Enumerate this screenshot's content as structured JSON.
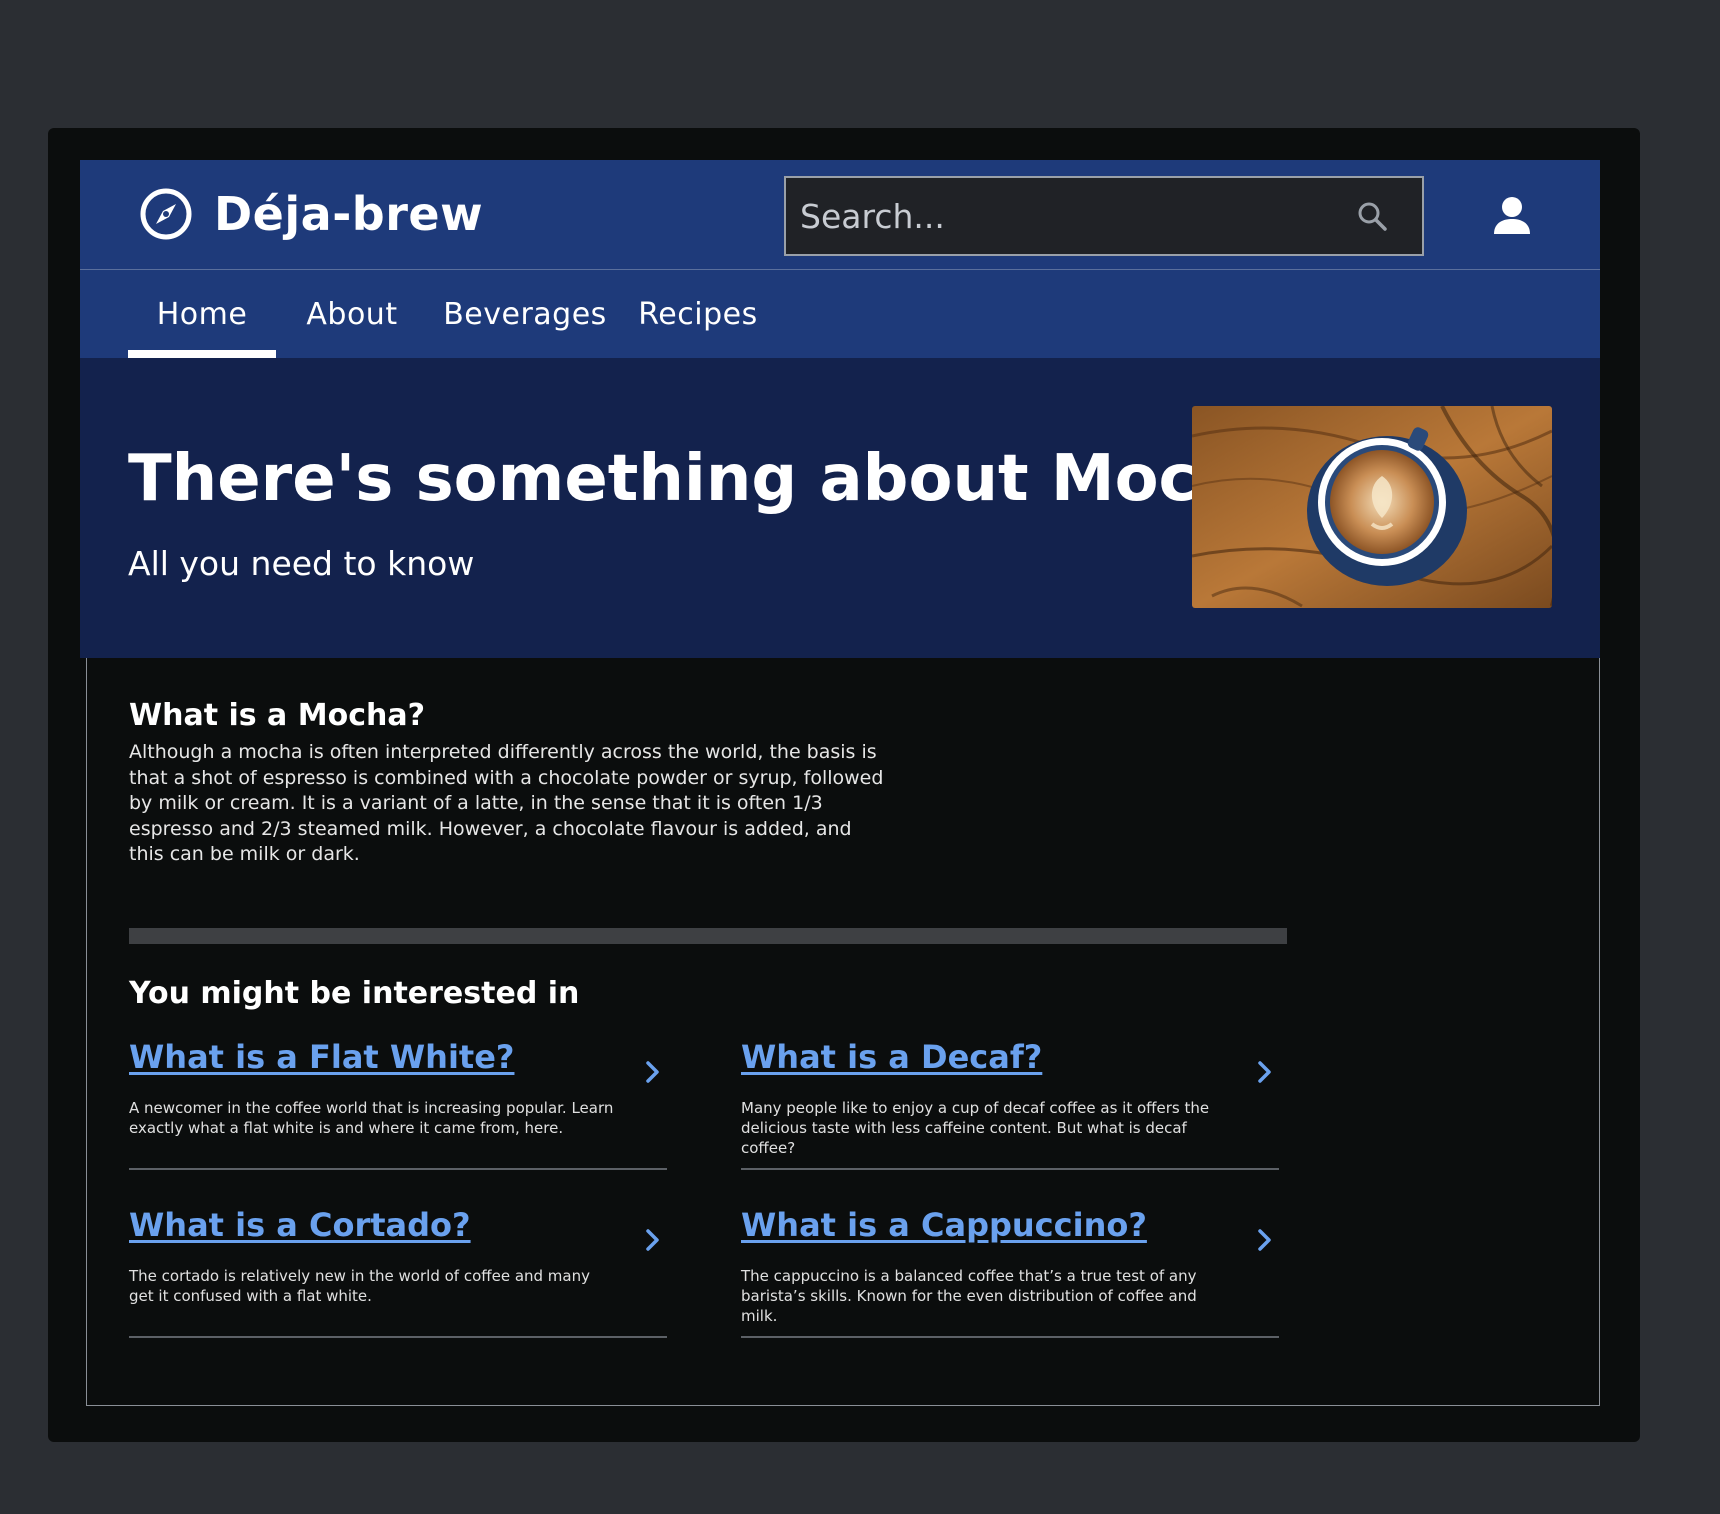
{
  "brand": {
    "name": "Déja-brew"
  },
  "search": {
    "placeholder": "Search..."
  },
  "nav": {
    "tabs": [
      {
        "label": "Home",
        "active": true
      },
      {
        "label": "About",
        "active": false
      },
      {
        "label": "Beverages",
        "active": false
      },
      {
        "label": "Recipes",
        "active": false
      }
    ]
  },
  "hero": {
    "title": "There's something about Mocha",
    "subtitle": "All you need to know"
  },
  "article": {
    "heading": "What is a Mocha?",
    "body": "Although a mocha is often interpreted differently across the world, the basis is that a shot of espresso is combined with a chocolate powder or syrup, followed by milk or cream. It is a variant of a latte, in the sense that it is often 1/3 espresso and 2/3 steamed milk. However, a chocolate flavour is added, and this can be milk or dark."
  },
  "related": {
    "heading": "You might be interested in",
    "cards": [
      {
        "title": "What is a Flat White?",
        "description": "A newcomer in the coffee world that is increasing popular. Learn exactly what a flat white is and where it came from, here."
      },
      {
        "title": "What is a Decaf?",
        "description": "Many people like to enjoy a cup of decaf coffee as it offers the delicious taste with less caffeine content. But what is decaf coffee?"
      },
      {
        "title": "What is a Cortado?",
        "description": "The cortado is relatively new in the world of coffee and many get it confused with a flat white."
      },
      {
        "title": "What is a Cappuccino?",
        "description": "The cappuccino is a balanced coffee that’s a true test of any barista’s skills. Known for the even distribution of coffee and milk."
      }
    ]
  },
  "colors": {
    "header_bg": "#1e3a7a",
    "hero_bg": "#13224d",
    "page_bg": "#0b0d0d",
    "link": "#6aa1ee"
  },
  "icons": {
    "logo": "compass-icon",
    "search": "search-icon",
    "user": "user-icon",
    "card_arrow": "chevron-right-icon"
  }
}
